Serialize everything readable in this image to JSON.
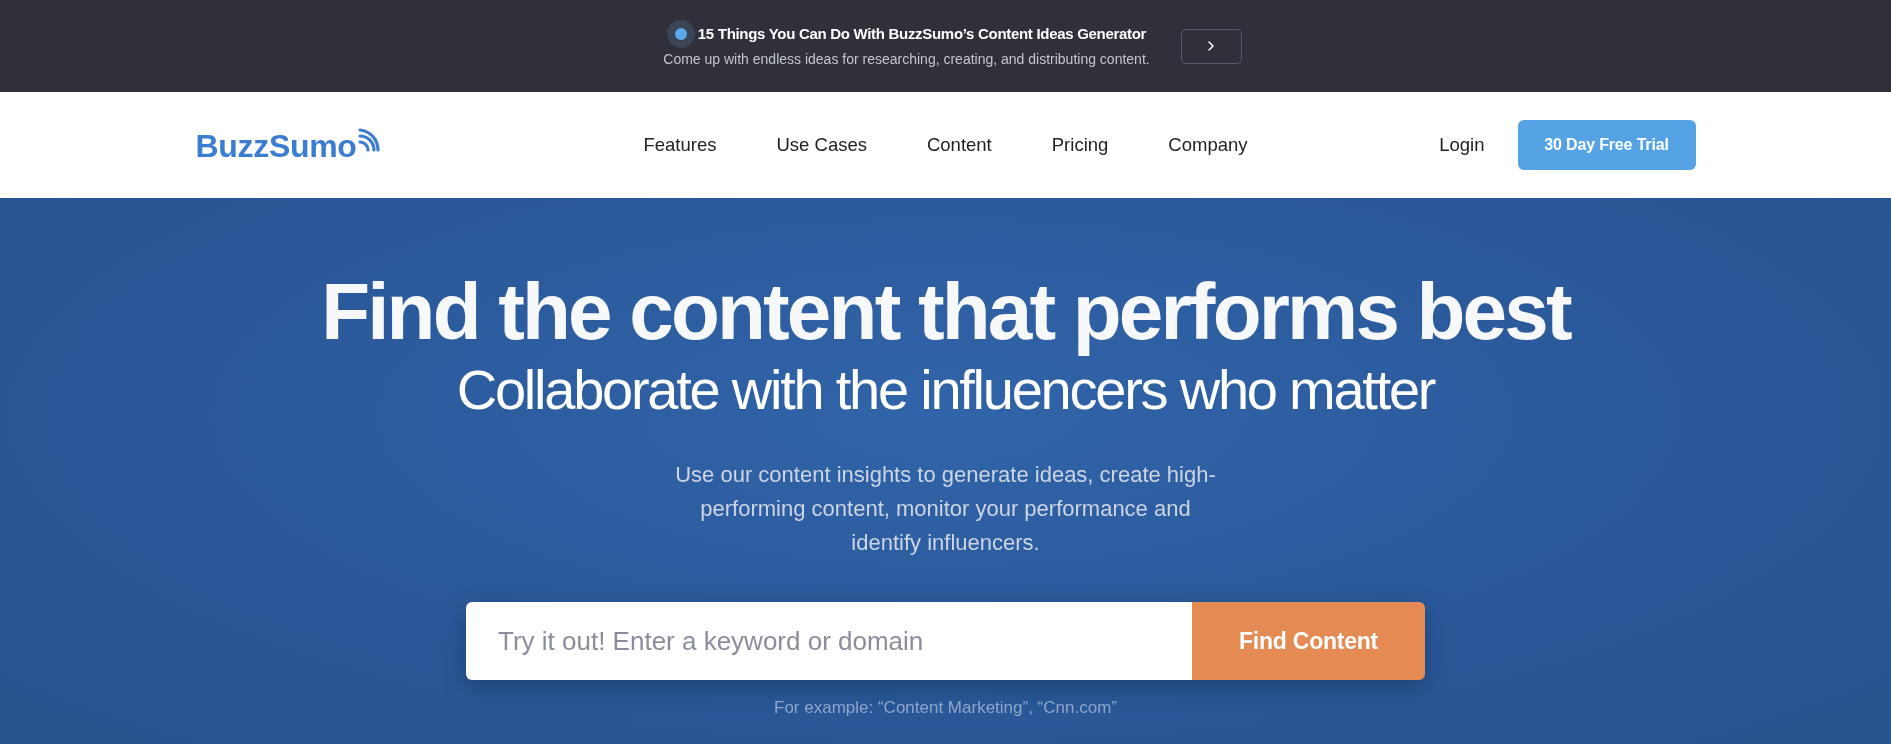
{
  "announcement": {
    "title": "15 Things You Can Do With BuzzSumo’s Content Ideas Generator",
    "subtitle": "Come up with endless ideas for researching, creating, and distributing content."
  },
  "navbar": {
    "logo": "BuzzSumo",
    "links": [
      "Features",
      "Use Cases",
      "Content",
      "Pricing",
      "Company"
    ],
    "login": "Login",
    "cta": "30 Day Free Trial"
  },
  "hero": {
    "headline": "Find the content that performs best",
    "subheadline": "Collaborate with the influencers who matter",
    "description": "Use our content insights to generate ideas, create high-performing content, monitor your performance and identify influencers.",
    "search": {
      "placeholder": "Try it out! Enter a keyword or domain",
      "button": "Find Content"
    },
    "example": "For example: “Content Marketing”, “Cnn.com”"
  }
}
